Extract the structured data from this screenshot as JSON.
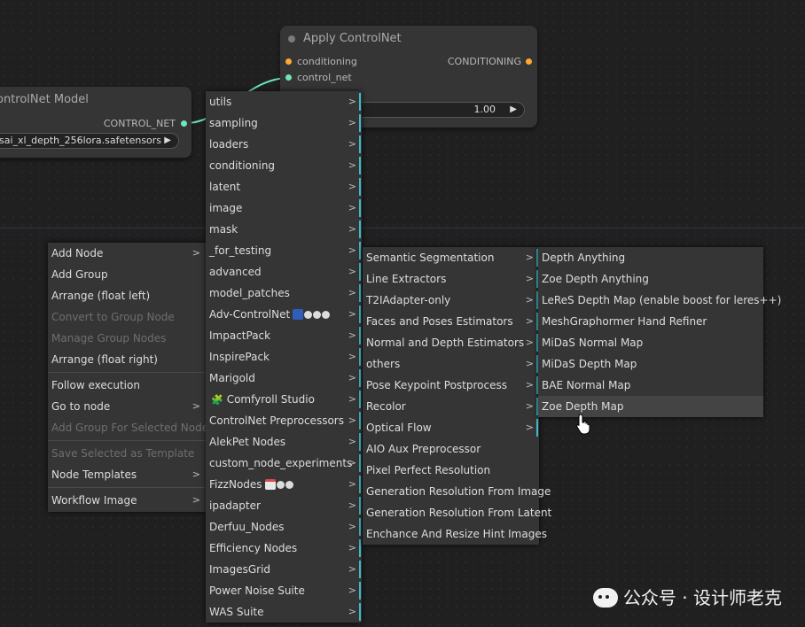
{
  "nodes": {
    "apply_controlnet": {
      "title": "Apply ControlNet",
      "inputs": [
        "conditioning",
        "control_net"
      ],
      "output": "CONDITIONING",
      "strength_value": "1.00"
    },
    "load_controlnet": {
      "title": "ontrolNet Model",
      "output": "CONTROL_NET",
      "model_value": "sai_xl_depth_256lora.safetensors"
    }
  },
  "context_menu": {
    "items": [
      {
        "label": "Add Node",
        "submenu": true
      },
      {
        "label": "Add Group"
      },
      {
        "label": "Arrange (float left)"
      },
      {
        "label": "Convert to Group Node",
        "disabled": true
      },
      {
        "label": "Manage Group Nodes",
        "disabled": true
      },
      {
        "label": "Arrange (float right)"
      },
      {
        "label": "Follow execution"
      },
      {
        "label": "Go to node",
        "submenu": true
      },
      {
        "label": "Add Group For Selected Nodes",
        "disabled": true
      },
      {
        "label": "Save Selected as Template",
        "disabled": true
      },
      {
        "label": "Node Templates",
        "submenu": true
      },
      {
        "label": "Workflow Image",
        "submenu": true
      }
    ]
  },
  "category_menu": {
    "items": [
      "utils",
      "sampling",
      "loaders",
      "conditioning",
      "latent",
      "image",
      "mask",
      "_for_testing",
      "advanced",
      "model_patches",
      "Adv-ControlNet",
      "ImpactPack",
      "InspirePack",
      "Marigold",
      "Comfyroll Studio",
      "ControlNet Preprocessors",
      "AlekPet Nodes",
      "custom_node_experiments",
      "FizzNodes",
      "ipadapter",
      "Derfuu_Nodes",
      "Efficiency Nodes",
      "ImagesGrid",
      "Power Noise Suite",
      "WAS Suite"
    ]
  },
  "preprocessor_menu": {
    "items": [
      {
        "label": "Semantic Segmentation",
        "submenu": true
      },
      {
        "label": "Line Extractors",
        "submenu": true
      },
      {
        "label": "T2IAdapter-only",
        "submenu": true
      },
      {
        "label": "Faces and Poses Estimators",
        "submenu": true
      },
      {
        "label": "Normal and Depth Estimators",
        "submenu": true
      },
      {
        "label": "others",
        "submenu": true
      },
      {
        "label": "Pose Keypoint Postprocess",
        "submenu": true
      },
      {
        "label": "Recolor",
        "submenu": true
      },
      {
        "label": "Optical Flow",
        "submenu": true
      },
      {
        "label": "AIO Aux Preprocessor"
      },
      {
        "label": "Pixel Perfect Resolution"
      },
      {
        "label": "Generation Resolution From Image"
      },
      {
        "label": "Generation Resolution From Latent"
      },
      {
        "label": "Enchance And Resize Hint Images"
      }
    ]
  },
  "depth_menu": {
    "items": [
      "Depth Anything",
      "Zoe Depth Anything",
      "LeReS Depth Map (enable boost for leres++)",
      "MeshGraphormer Hand Refiner",
      "MiDaS Normal Map",
      "MiDaS Depth Map",
      "BAE Normal Map",
      "Zoe Depth Map"
    ],
    "highlighted": "Zoe Depth Map"
  },
  "icons": {
    "submenu_arrow": ">",
    "widget_arrow": "▶"
  },
  "colors": {
    "accent_bar": "#3fb9c9",
    "conditioning_slot": "#ffa931",
    "control_net_slot": "#6ee7b7",
    "link": "#6ee7b7"
  },
  "watermark": "公众号 · 设计师老克"
}
